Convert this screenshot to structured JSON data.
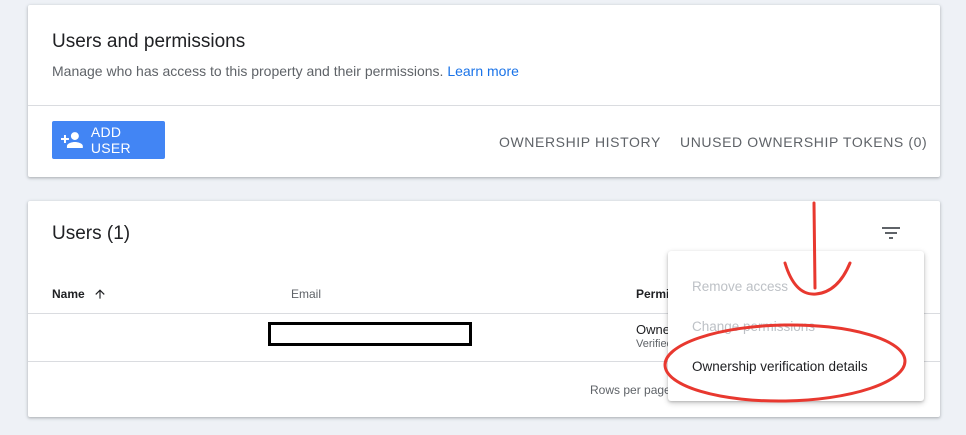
{
  "header": {
    "title": "Users and permissions",
    "description": "Manage who has access to this property and their permissions.",
    "learn_more": "Learn more"
  },
  "actions": {
    "add_user": "ADD USER",
    "ownership_history": "OWNERSHIP HISTORY",
    "unused_tokens": "UNUSED OWNERSHIP TOKENS (0)"
  },
  "users": {
    "title": "Users (1)",
    "columns": [
      "Name",
      "Email",
      "Permission"
    ],
    "rows": [
      {
        "name": "",
        "email": "",
        "permission": "Owner",
        "permission_note": "Verified"
      }
    ],
    "rows_per_page_label": "Rows per page"
  },
  "menu": {
    "items": [
      {
        "label": "Remove access",
        "enabled": false
      },
      {
        "label": "Change permissions",
        "enabled": false
      },
      {
        "label": "Ownership verification details",
        "enabled": true
      }
    ]
  },
  "colors": {
    "accent": "#4285f4",
    "link": "#1a73e8",
    "annotation": "#e8382f",
    "background": "#eef1f6"
  },
  "icons": [
    "person-add-icon",
    "sort-arrow-up-icon",
    "filter-icon"
  ]
}
